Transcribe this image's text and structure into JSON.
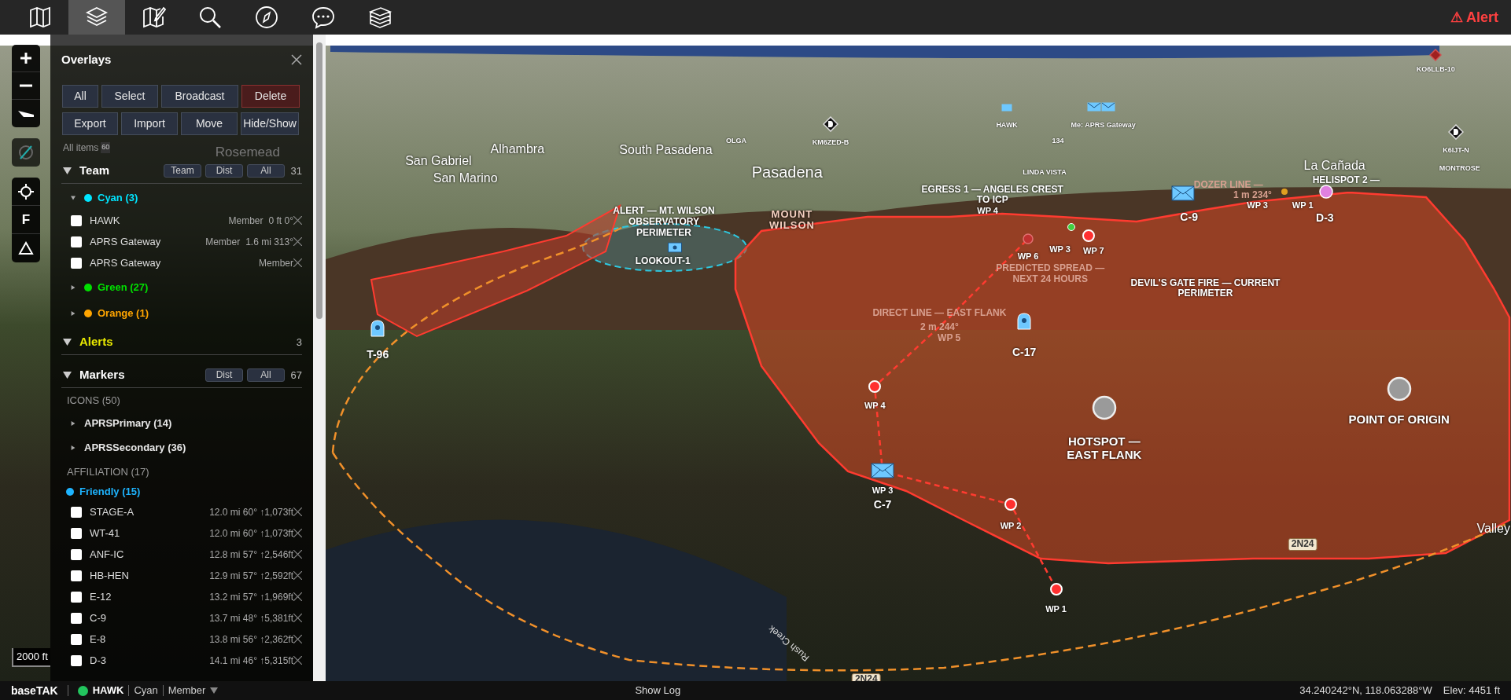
{
  "top_bar": {
    "nav_buttons": [
      {
        "selected": false
      },
      {
        "selected": true
      },
      {
        "selected": false
      },
      {
        "selected": false
      },
      {
        "selected": false
      },
      {
        "selected": false
      },
      {
        "selected": false
      }
    ],
    "alert_button": "⚠ Alert"
  },
  "map_controls": {
    "f_label": "F"
  },
  "overlays": {
    "title": "Overlays",
    "buttons": [
      {
        "label": "All",
        "kind": "normal"
      },
      {
        "label": "Select",
        "kind": "normal"
      },
      {
        "label": "Broadcast",
        "kind": "normal"
      },
      {
        "label": "Delete",
        "kind": "danger"
      },
      {
        "label": "Export",
        "kind": "normal"
      },
      {
        "label": "Import",
        "kind": "normal"
      },
      {
        "label": "Move",
        "kind": "normal"
      },
      {
        "label": "Hide/Show",
        "kind": "normal"
      }
    ],
    "all_items_label": "All items",
    "all_items_count": "60",
    "team": {
      "title": "Team",
      "expanded": true,
      "buttons": [
        "Team",
        "Dist",
        "All"
      ],
      "count": "31",
      "groups": [
        {
          "name": "Cyan (3)",
          "color": "#00e5ff",
          "expanded": true,
          "items": [
            {
              "name": "HAWK",
              "role": "Member",
              "info": "0 ft 0°",
              "checked": false
            },
            {
              "name": "APRS Gateway",
              "role": "Member",
              "info": "1.6 mi 313°",
              "checked": false
            },
            {
              "name": "APRS Gateway",
              "role": "Member",
              "checked": false
            }
          ]
        },
        {
          "name": "Green (27)",
          "color": "#00e000",
          "expanded": false
        },
        {
          "name": "Orange (1)",
          "color": "#ffa500",
          "expanded": false
        }
      ]
    },
    "alerts": {
      "title": "Alerts",
      "expanded": true,
      "count": "3"
    },
    "markers": {
      "title": "Markers",
      "expanded": true,
      "buttons": [
        "Dist",
        "All"
      ],
      "count": "67",
      "categories": [
        {
          "heading": "ICONS (50)",
          "groups": [
            {
              "name": "APRSPrimary (14)",
              "expanded": false
            },
            {
              "name": "APRSSecondary (36)",
              "expanded": false
            }
          ]
        },
        {
          "heading": "AFFILIATION (17)",
          "groups": [
            {
              "name": "Friendly (15)",
              "color": "#1eb4ff",
              "items": [
                {
                  "name": "STAGE-A",
                  "info": "12.0 mi 60° ↑1,073ft",
                  "checked": false
                },
                {
                  "name": "WT-41",
                  "info": "12.0 mi 60° ↑1,073ft",
                  "checked": false
                },
                {
                  "name": "ANF-IC",
                  "info": "12.8 mi 57° ↑2,546ft",
                  "checked": false
                },
                {
                  "name": "HB-HEN",
                  "info": "12.9 mi 57° ↑2,592ft",
                  "checked": false
                },
                {
                  "name": "E-12",
                  "info": "13.2 mi 57° ↑1,969ft",
                  "checked": false
                },
                {
                  "name": "C-9",
                  "info": "13.7 mi 48° ↑5,381ft",
                  "checked": false
                },
                {
                  "name": "E-8",
                  "info": "13.8 mi 56° ↑2,362ft",
                  "checked": false
                },
                {
                  "name": "D-3",
                  "info": "14.1 mi 46° ↑5,315ft",
                  "checked": false
                }
              ]
            }
          ]
        }
      ]
    }
  },
  "map": {
    "scale": "2000 ft",
    "labels": [
      {
        "text": "Alhambra",
        "kind": "place"
      },
      {
        "text": "San Gabriel",
        "kind": "place"
      },
      {
        "text": "San Marino",
        "kind": "place"
      },
      {
        "text": "South Pasadena",
        "kind": "place"
      },
      {
        "text": "Pasadena",
        "kind": "city"
      },
      {
        "text": "Rosemead",
        "kind": "dim"
      },
      {
        "text": "OLGA",
        "kind": "small"
      },
      {
        "text": "KM6ZED-B",
        "kind": "small"
      },
      {
        "text": "HAWK",
        "kind": "small"
      },
      {
        "text": "Me: APRS Gateway",
        "kind": "small"
      },
      {
        "text": "134",
        "kind": "small"
      },
      {
        "text": "LINDA VISTA",
        "kind": "small"
      },
      {
        "text": "KO6LLB-10",
        "kind": "small"
      },
      {
        "text": "La Cañada",
        "kind": "place"
      },
      {
        "text": "K6IJT-N",
        "kind": "small"
      },
      {
        "text": "MONTROSE",
        "kind": "small"
      },
      {
        "text": "ALERT — MT. WILSON OBSERVATORY PERIMETER",
        "kind": "feature"
      },
      {
        "text": "LOOKOUT-1",
        "kind": "feature"
      },
      {
        "text": "MOUNT WILSON",
        "kind": "terrain"
      },
      {
        "text": "EGRESS 1 — ANGELES CREST TO ICP",
        "kind": "feature"
      },
      {
        "text": "WP 4",
        "kind": "waypoint"
      },
      {
        "text": "PREDICTED SPREAD — NEXT 24 HOURS",
        "kind": "faded"
      },
      {
        "text": "WP 6",
        "kind": "waypoint"
      },
      {
        "text": "WP 3",
        "kind": "waypoint"
      },
      {
        "text": "WP 7",
        "kind": "waypoint"
      },
      {
        "text": "C-9",
        "kind": "callsign"
      },
      {
        "text": "DOZER LINE —",
        "kind": "faded"
      },
      {
        "text": "HELISPOT 2 —",
        "kind": "feature"
      },
      {
        "text": "1 m 234°",
        "kind": "faded"
      },
      {
        "text": "WP 3",
        "kind": "waypoint"
      },
      {
        "text": "WP 1",
        "kind": "waypoint"
      },
      {
        "text": "D-3",
        "kind": "callsign"
      },
      {
        "text": "DEVIL'S GATE FIRE — CURRENT PERIMETER",
        "kind": "feature"
      },
      {
        "text": "DIRECT LINE — EAST FLANK",
        "kind": "faded"
      },
      {
        "text": "2 m 244°",
        "kind": "faded"
      },
      {
        "text": "WP 5",
        "kind": "faded"
      },
      {
        "text": "C-17",
        "kind": "callsign"
      },
      {
        "text": "T-96",
        "kind": "callsign"
      },
      {
        "text": "WP 4",
        "kind": "waypoint"
      },
      {
        "text": "HOTSPOT — EAST FLANK",
        "kind": "large"
      },
      {
        "text": "POINT OF ORIGIN",
        "kind": "large"
      },
      {
        "text": "WP 3",
        "kind": "waypoint"
      },
      {
        "text": "C-7",
        "kind": "callsign"
      },
      {
        "text": "WP 2",
        "kind": "waypoint"
      },
      {
        "text": "WP 1",
        "kind": "waypoint"
      },
      {
        "text": "2N24",
        "kind": "road"
      },
      {
        "text": "2N24",
        "kind": "road"
      },
      {
        "text": "Valley",
        "kind": "place"
      },
      {
        "text": "Rush Creek",
        "kind": "creek"
      }
    ]
  },
  "status_bar": {
    "app": "baseTAK",
    "user": "HAWK",
    "online": true,
    "team": "Cyan",
    "role": "Member",
    "show_log": "Show Log",
    "coordinates": "34.240242°N, 118.063288°W",
    "elevation": "Elev: 4451 ft"
  }
}
